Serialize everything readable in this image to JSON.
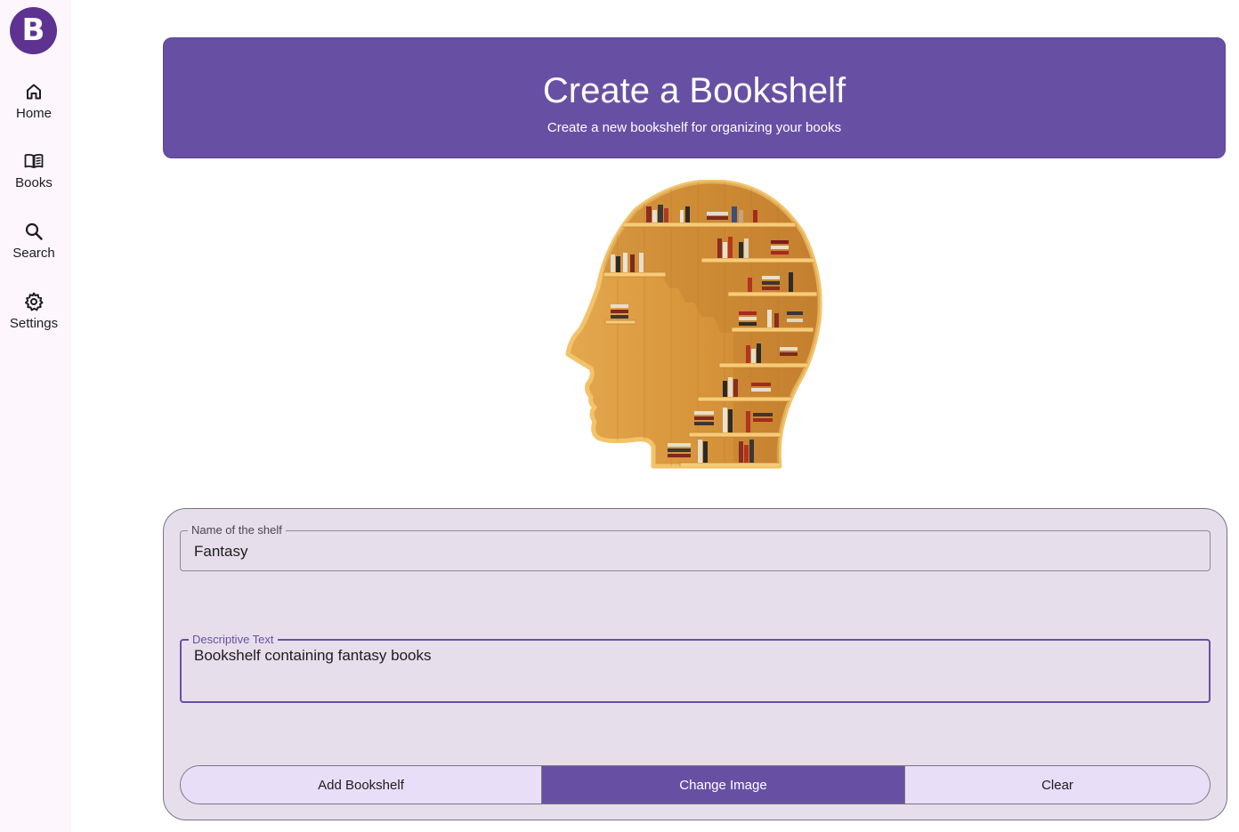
{
  "app": {
    "logo_letter": "B"
  },
  "nav": {
    "items": [
      {
        "label": "Home",
        "icon": "home-icon"
      },
      {
        "label": "Books",
        "icon": "book-icon"
      },
      {
        "label": "Search",
        "icon": "search-icon"
      },
      {
        "label": "Settings",
        "icon": "gear-icon"
      }
    ]
  },
  "header": {
    "title": "Create a Bookshelf",
    "subtitle": "Create a new bookshelf for organizing your books"
  },
  "hero_image": {
    "icon": "head-bookshelf-illustration"
  },
  "form": {
    "name_field": {
      "label": "Name of the shelf",
      "value": "Fantasy"
    },
    "description_field": {
      "label": "Descriptive Text",
      "value": "Bookshelf containing fantasy books"
    },
    "buttons": {
      "add": "Add Bookshelf",
      "change_image": "Change Image",
      "clear": "Clear"
    }
  },
  "colors": {
    "primary": "#6750a4",
    "logo": "#5e3291",
    "card_background": "#e6dfeb",
    "button_background": "#e8def8"
  }
}
